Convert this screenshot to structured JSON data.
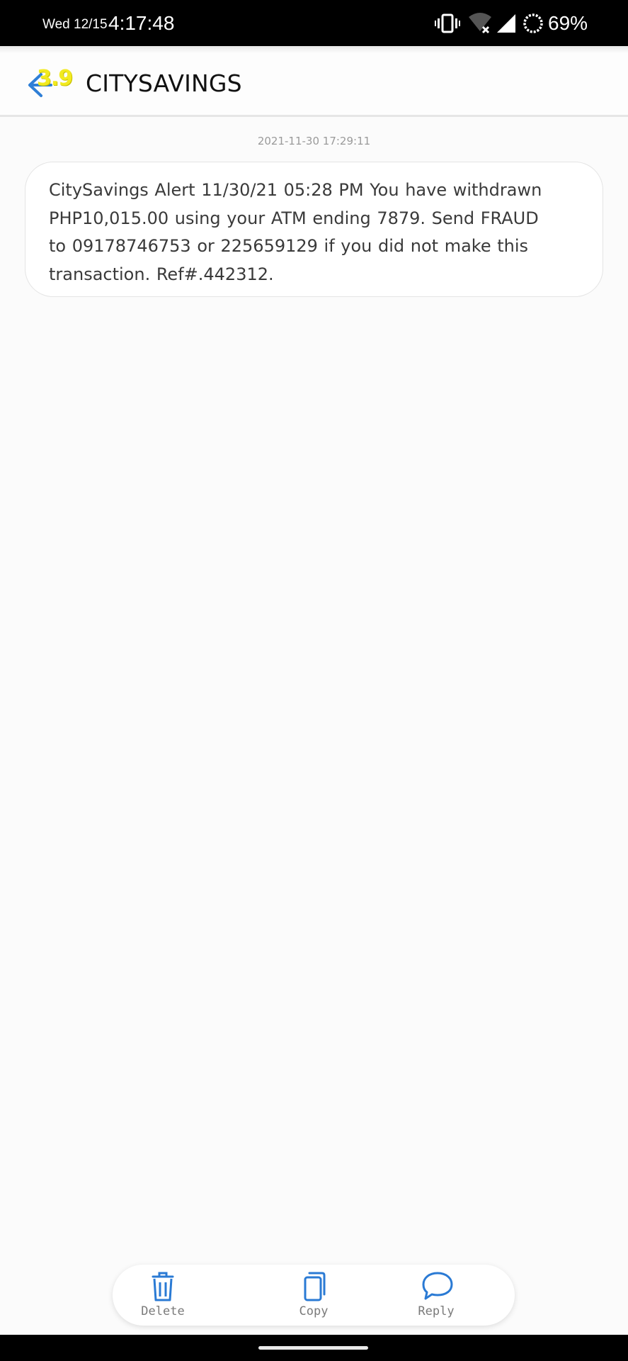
{
  "status_bar": {
    "day": "Wed 12/15",
    "time": "4:17:48",
    "battery": "69%",
    "icons": [
      "vibrate-icon",
      "wifi-off-icon",
      "signal-icon",
      "battery-ring-icon"
    ]
  },
  "header": {
    "back_badge": "3.9",
    "title": "CITYSAVINGS",
    "accent_color": "#2f7fd6"
  },
  "conversation": {
    "timestamp": "2021-11-30 17:29:11",
    "message_lines": [
      "CitySavings Alert 11/30/21 05:28 PM You have withdrawn",
      "PHP10,015.00 using your ATM ending 7879. Send FRAUD",
      "to 09178746753 or 225659129 if you did not make this",
      "transaction. Ref#.442312."
    ]
  },
  "actions": {
    "delete_label": "Delete",
    "copy_label": "Copy",
    "reply_label": "Reply",
    "icon_color": "#2a7ad4"
  }
}
